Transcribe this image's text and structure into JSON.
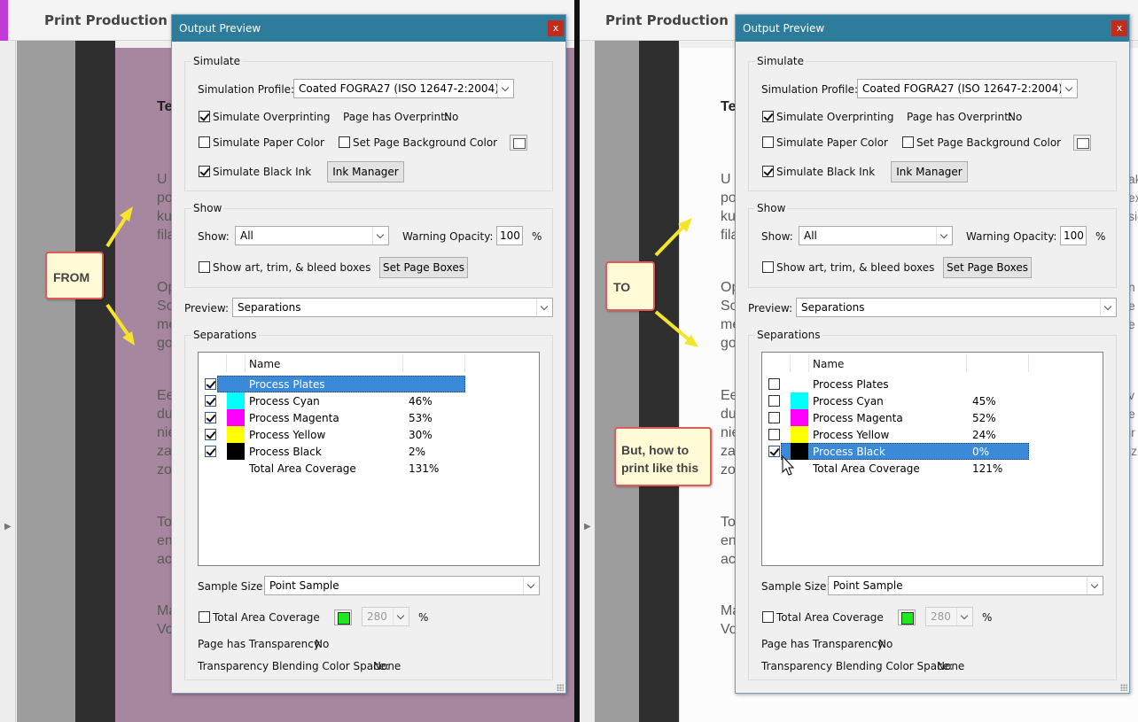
{
  "app_title": "Print Production",
  "accent_color": "#c13bd6",
  "dialog": {
    "title": "Output Preview",
    "close": "x",
    "simulate_group": "Simulate",
    "simulation_profile_label": "Simulation Profile:",
    "simulation_profile_value": "Coated FOGRA27 (ISO 12647-2:2004)",
    "simulate_overprinting": "Simulate Overprinting",
    "page_has_overprint_label": "Page has Overprint:",
    "page_has_overprint_value": "No",
    "simulate_paper_color": "Simulate Paper Color",
    "set_page_background_color": "Set Page Background Color",
    "simulate_black_ink": "Simulate Black Ink",
    "ink_manager": "Ink Manager",
    "show_group": "Show",
    "show_label": "Show:",
    "show_value": "All",
    "warning_opacity_label": "Warning Opacity:",
    "warning_opacity_value": "100",
    "percent": "%",
    "show_boxes": "Show art, trim, & bleed boxes",
    "set_page_boxes": "Set Page Boxes",
    "preview_label": "Preview:",
    "preview_value": "Separations",
    "separations_group": "Separations",
    "col_name": "Name",
    "sample_size_label": "Sample Size:",
    "sample_size_value": "Point Sample",
    "total_area_coverage_check": "Total Area Coverage",
    "tac_value": "280",
    "page_has_transparency_label": "Page has Transparency:",
    "page_has_transparency_value": "No",
    "blending_label": "Transparency Blending Color Space:",
    "blending_value": "None"
  },
  "left": {
    "callout": "FROM",
    "separations": [
      {
        "name": "Process Plates",
        "value": "",
        "checked": true,
        "color": null
      },
      {
        "name": "Process Cyan",
        "value": "46%",
        "checked": true,
        "color": "#00ffff"
      },
      {
        "name": "Process Magenta",
        "value": "53%",
        "checked": true,
        "color": "#ff00ff"
      },
      {
        "name": "Process Yellow",
        "value": "30%",
        "checked": true,
        "color": "#ffff00"
      },
      {
        "name": "Process Black",
        "value": "2%",
        "checked": true,
        "color": "#000000"
      },
      {
        "name": "Total Area Coverage",
        "value": "131%",
        "checked": null,
        "color": null
      }
    ],
    "page_text": [
      "Te",
      "U",
      "po",
      "ku",
      "fila",
      "Op",
      "So",
      "me",
      "go",
      "Ee",
      "du",
      "nie",
      "za",
      "zo",
      "To",
      "en",
      "ac",
      "Ma",
      "Vo"
    ]
  },
  "right": {
    "callout": "TO",
    "question": "But, how to print like this",
    "separations": [
      {
        "name": "Process Plates",
        "value": "",
        "checked": false,
        "color": null
      },
      {
        "name": "Process Cyan",
        "value": "45%",
        "checked": false,
        "color": "#00ffff"
      },
      {
        "name": "Process Magenta",
        "value": "52%",
        "checked": false,
        "color": "#ff00ff"
      },
      {
        "name": "Process Yellow",
        "value": "24%",
        "checked": false,
        "color": "#ffff00"
      },
      {
        "name": "Process Black",
        "value": "0%",
        "checked": true,
        "color": "#000000"
      },
      {
        "name": "Total Area Coverage",
        "value": "121%",
        "checked": null,
        "color": null
      }
    ],
    "page_text": [
      "Te",
      "U",
      "po",
      "ku",
      "fila",
      "Op",
      "So",
      "me",
      "go",
      "Ee",
      "du",
      "nie",
      "za",
      "zo",
      "To",
      "en",
      "ac",
      "Ma",
      "Vo"
    ],
    "edge_text": [
      "ak",
      "ex",
      "sie",
      "n",
      "e",
      "e",
      "v",
      "e",
      "ir",
      "jz"
    ]
  }
}
